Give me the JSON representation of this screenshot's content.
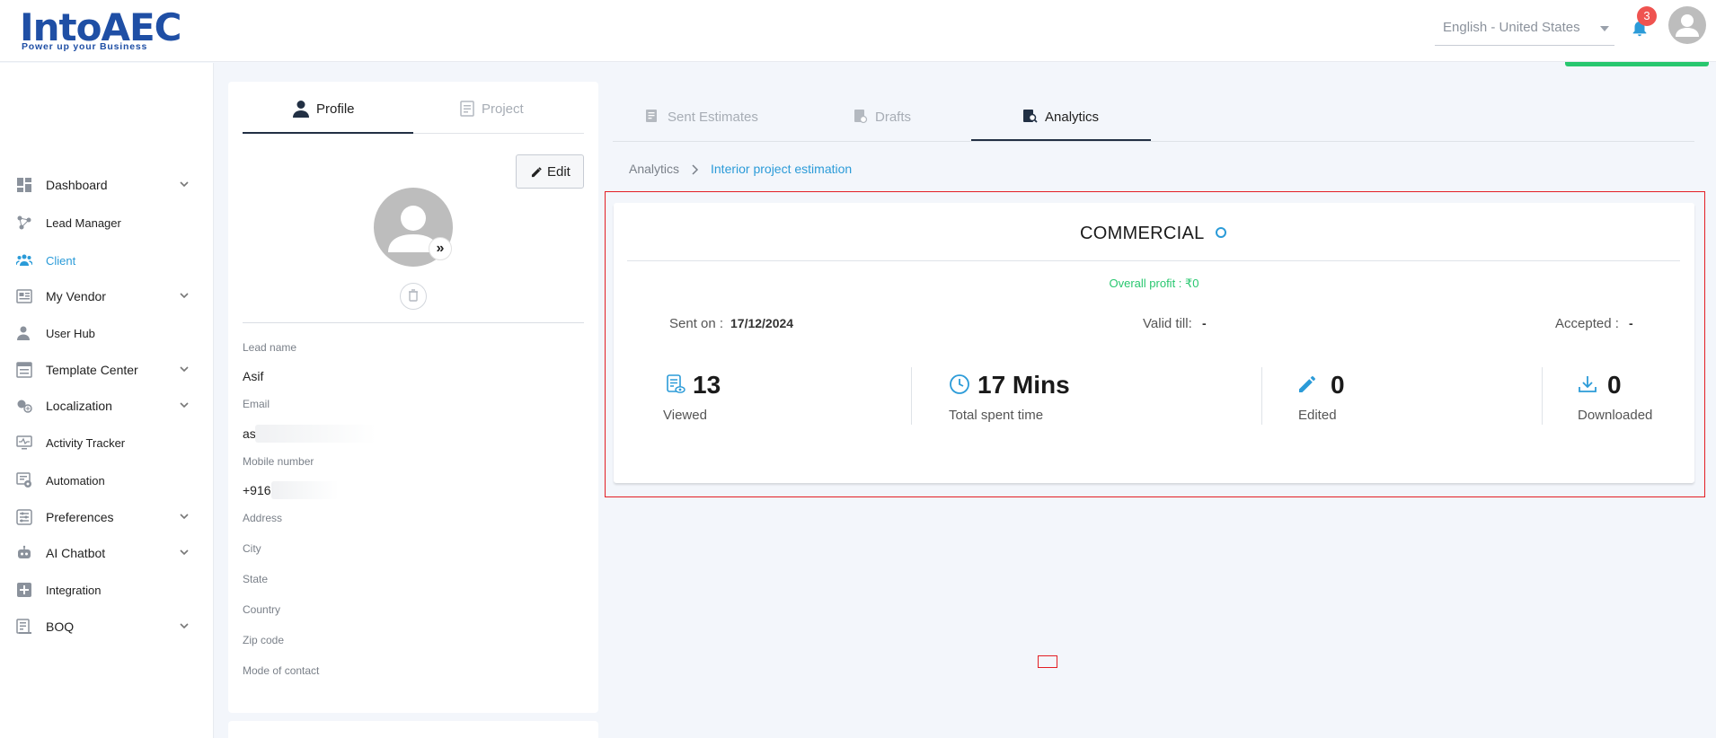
{
  "brand": {
    "name": "IntoAEC",
    "tagline": "Power up your Business"
  },
  "header": {
    "language": "English - United States",
    "notification_count": "3"
  },
  "sidebar": {
    "items": [
      {
        "label": "Dashboard",
        "icon": "dashboard-icon",
        "expandable": true
      },
      {
        "label": "Lead Manager",
        "icon": "lead-manager-icon",
        "expandable": false
      },
      {
        "label": "Client",
        "icon": "client-icon",
        "expandable": false,
        "active": true
      },
      {
        "label": "My Vendor",
        "icon": "vendor-icon",
        "expandable": true
      },
      {
        "label": "User Hub",
        "icon": "user-hub-icon",
        "expandable": false
      },
      {
        "label": "Template Center",
        "icon": "template-icon",
        "expandable": true
      },
      {
        "label": "Localization",
        "icon": "localization-icon",
        "expandable": true
      },
      {
        "label": "Activity Tracker",
        "icon": "activity-icon",
        "expandable": false
      },
      {
        "label": "Automation",
        "icon": "automation-icon",
        "expandable": false
      },
      {
        "label": "Preferences",
        "icon": "preferences-icon",
        "expandable": true
      },
      {
        "label": "AI Chatbot",
        "icon": "chatbot-icon",
        "expandable": true
      },
      {
        "label": "Integration",
        "icon": "integration-icon",
        "expandable": false
      },
      {
        "label": "BOQ",
        "icon": "boq-icon",
        "expandable": true
      }
    ]
  },
  "profile_panel": {
    "tabs": {
      "profile": "Profile",
      "project": "Project"
    },
    "edit_label": "Edit",
    "fields": {
      "lead_name_label": "Lead name",
      "lead_name_value": "Asif",
      "email_label": "Email",
      "email_value": "as",
      "mobile_label": "Mobile number",
      "mobile_value": "+916",
      "address_label": "Address",
      "city_label": "City",
      "state_label": "State",
      "country_label": "Country",
      "zip_label": "Zip code",
      "contact_mode_label": "Mode of contact"
    }
  },
  "main": {
    "tabs": {
      "sent_estimates": "Sent Estimates",
      "drafts": "Drafts",
      "analytics": "Analytics"
    },
    "breadcrumb": {
      "root": "Analytics",
      "leaf": "Interior project estimation"
    },
    "card": {
      "title": "COMMERCIAL",
      "overall_profit": "Overall profit : ₹0",
      "sent_on_label": "Sent on :",
      "sent_on_value": "17/12/2024",
      "valid_till_label": "Valid till:",
      "valid_till_value": "-",
      "accepted_label": "Accepted :",
      "accepted_value": "-",
      "stats": [
        {
          "value": "13",
          "label": "Viewed",
          "icon": "viewed-doc-icon"
        },
        {
          "value": "17 Mins",
          "label": "Total spent time",
          "icon": "clock-icon"
        },
        {
          "value": "0",
          "label": "Edited",
          "icon": "pencil-icon"
        },
        {
          "value": "0",
          "label": "Downloaded",
          "icon": "download-icon"
        }
      ]
    }
  },
  "colors": {
    "accent": "#2b9bd8",
    "profit": "#28c76f",
    "highlight": "#e31e24",
    "brand": "#1f4fa5"
  }
}
